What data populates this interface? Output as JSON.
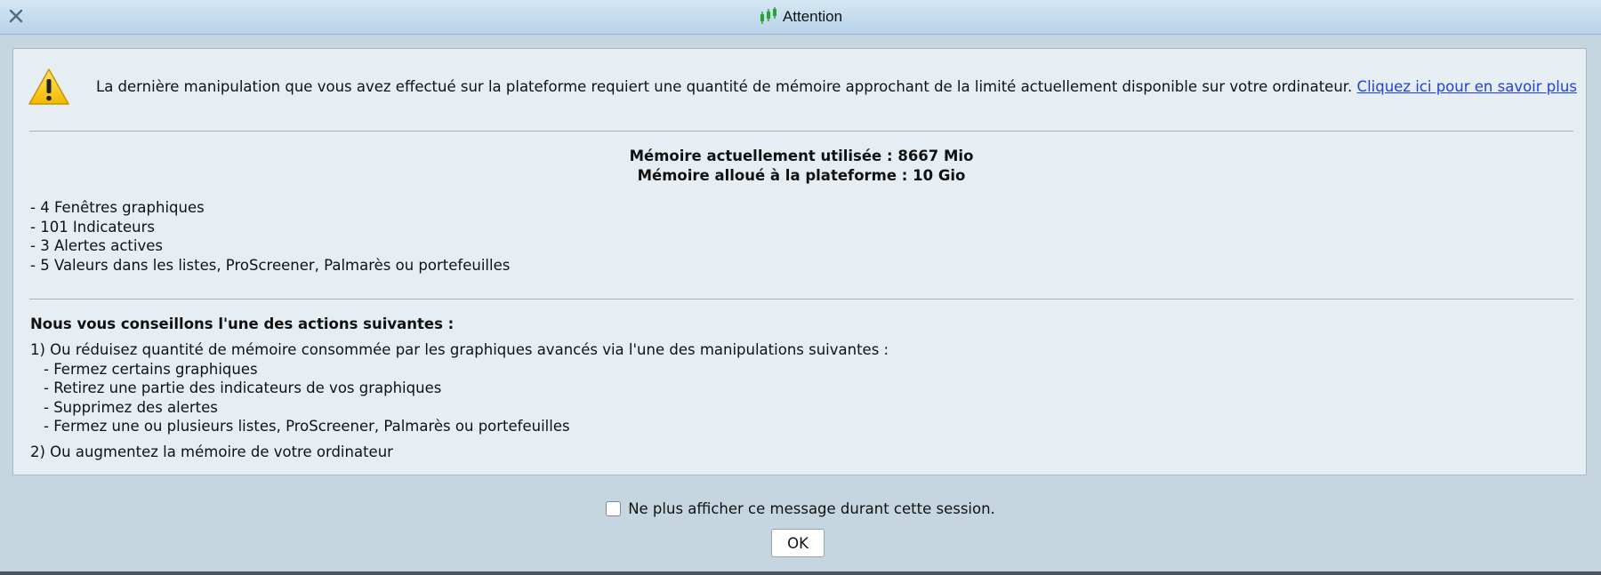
{
  "window": {
    "title": "Attention",
    "accent_color": "#b8d3e8"
  },
  "icons": {
    "close": "close-icon",
    "app": "candlestick-icon",
    "warning": "warning-icon"
  },
  "message": {
    "text": "La dernière manipulation que vous avez effectué sur la plateforme requiert une quantité de mémoire approchant de la limité actuellement disponible sur votre ordinateur.",
    "link": "Cliquez ici pour en savoir plus"
  },
  "memory": {
    "used": "Mémoire actuellement utilisée : 8667 Mio",
    "allocated": "Mémoire alloué à la plateforme : 10 Gio"
  },
  "stats": [
    "- 4 Fenêtres graphiques",
    "- 101 Indicateurs",
    "- 3 Alertes actives",
    "- 5 Valeurs dans les listes, ProScreener, Palmarès ou portefeuilles"
  ],
  "advice": {
    "title": "Nous vous conseillons l'une des actions suivantes :",
    "option1": "1) Ou réduisez quantité de mémoire consommée par les graphiques avancés via l'une des manipulations suivantes :",
    "sub_items": [
      "- Fermez certains graphiques",
      "- Retirez une partie des indicateurs de vos graphiques",
      "- Supprimez des alertes",
      "- Fermez une ou plusieurs listes, ProScreener, Palmarès ou portefeuilles"
    ],
    "option2": "2) Ou augmentez la mémoire de votre ordinateur"
  },
  "footer": {
    "checkbox_label": "Ne plus afficher ce message durant cette session.",
    "checkbox_checked": false,
    "ok_label": "OK"
  }
}
